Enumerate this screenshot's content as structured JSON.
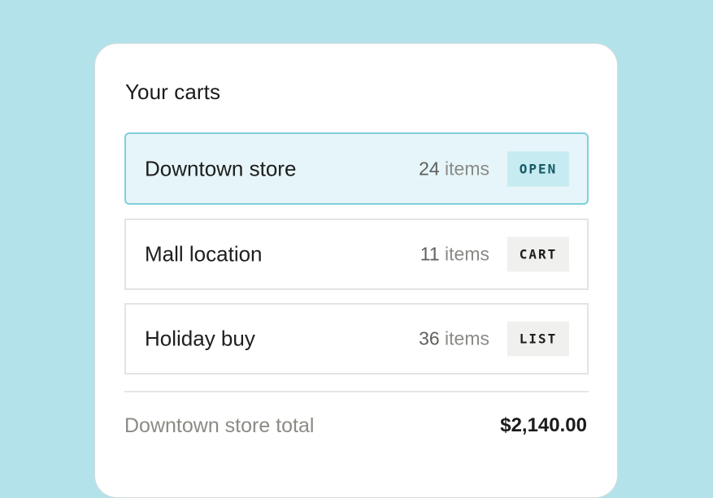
{
  "card": {
    "title": "Your carts",
    "carts": [
      {
        "name": "Downtown store",
        "count": "24",
        "unit": "items",
        "badge": "OPEN",
        "selected": true
      },
      {
        "name": "Mall location",
        "count": "11",
        "unit": "items",
        "badge": "CART",
        "selected": false
      },
      {
        "name": "Holiday buy",
        "count": "36",
        "unit": "items",
        "badge": "LIST",
        "selected": false
      }
    ],
    "total": {
      "label": "Downtown store total",
      "value": "$2,140.00"
    }
  },
  "colors": {
    "background": "#b3e2ea",
    "selected_border": "#7fcfdb",
    "selected_fill": "#e6f5f9",
    "selected_badge": "#c6ebf1"
  }
}
